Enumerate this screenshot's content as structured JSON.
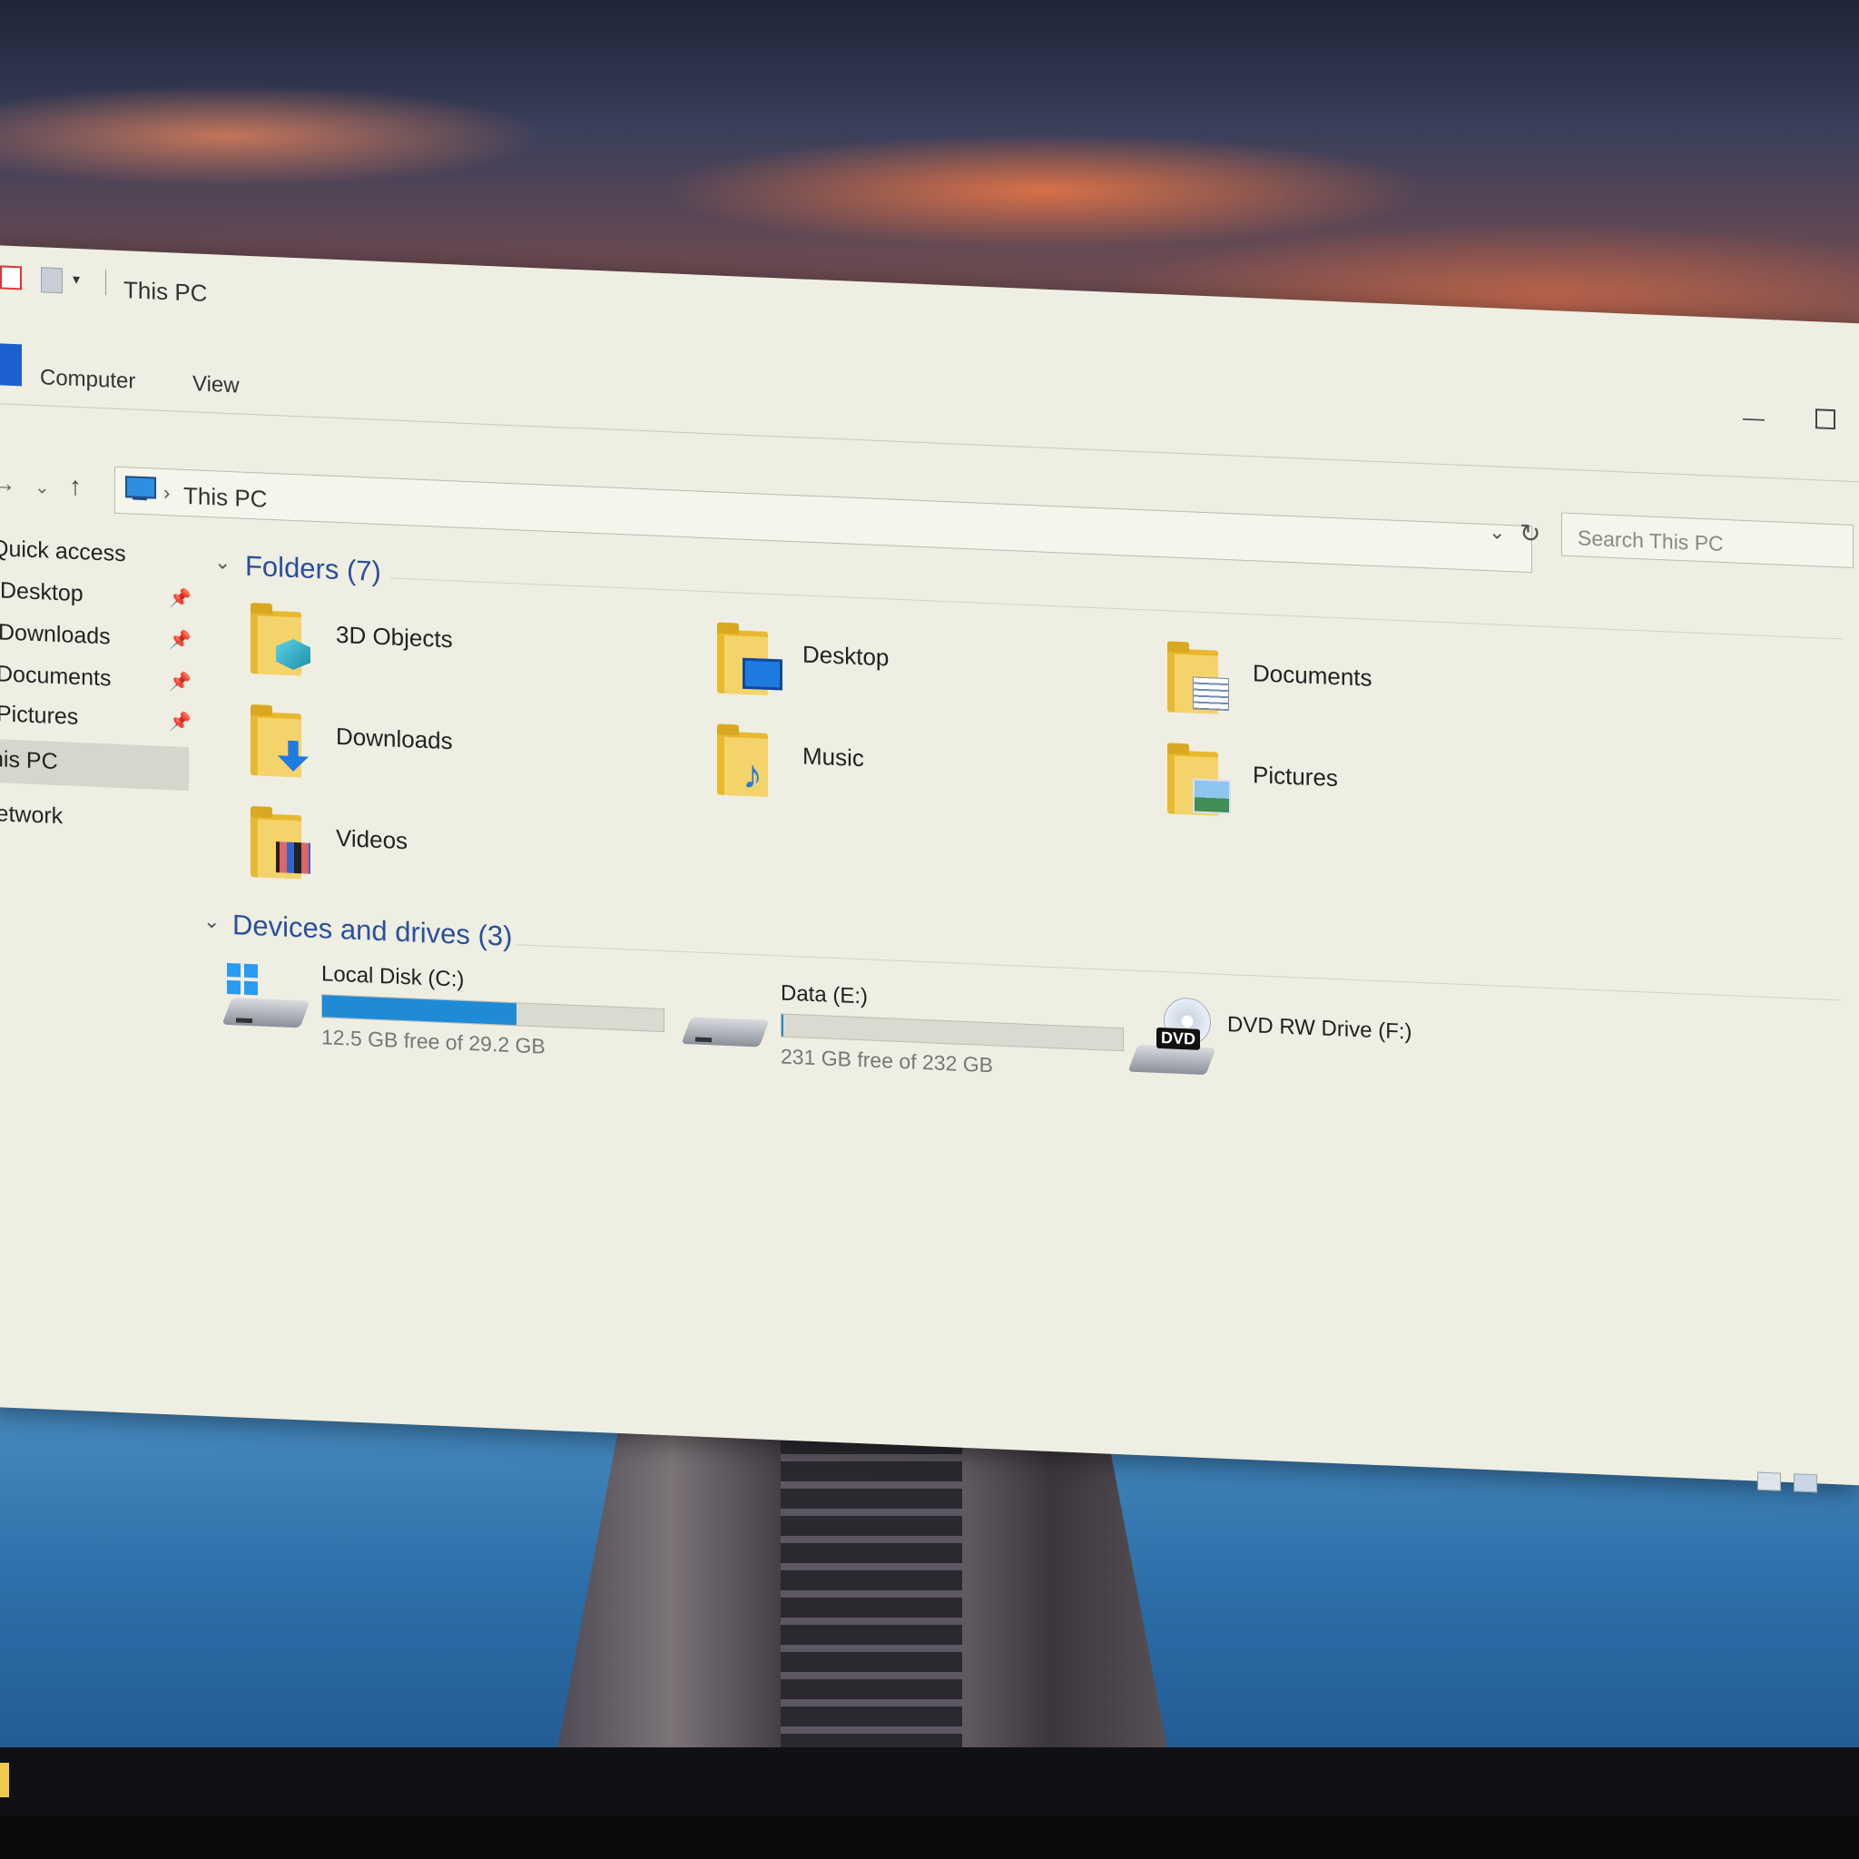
{
  "window": {
    "title": "This PC"
  },
  "ribbon": {
    "tabs": [
      "Computer",
      "View"
    ]
  },
  "address": {
    "crumb": "This PC"
  },
  "search": {
    "placeholder": "Search This PC"
  },
  "nav": {
    "quick_access": "Quick access",
    "items": [
      {
        "label": "Desktop",
        "pinned": true
      },
      {
        "label": "Downloads",
        "pinned": true
      },
      {
        "label": "Documents",
        "pinned": true
      },
      {
        "label": "Pictures",
        "pinned": true
      }
    ],
    "this_pc": "his PC",
    "network": "letwork"
  },
  "folders": {
    "header": "Folders (7)",
    "items": [
      {
        "label": "3D Objects",
        "icon": "3d-objects-icon"
      },
      {
        "label": "Desktop",
        "icon": "desktop-icon"
      },
      {
        "label": "Documents",
        "icon": "documents-icon"
      },
      {
        "label": "Downloads",
        "icon": "download-arrow-icon"
      },
      {
        "label": "Music",
        "icon": "music-note-icon"
      },
      {
        "label": "Pictures",
        "icon": "pictures-icon"
      },
      {
        "label": "Videos",
        "icon": "film-strip-icon"
      }
    ]
  },
  "drives": {
    "header": "Devices and drives (3)",
    "items": [
      {
        "name": "Local Disk (C:)",
        "free_text": "12.5 GB free of 29.2 GB",
        "used_fraction": 0.57,
        "icon": "windows-drive-icon"
      },
      {
        "name": "Data (E:)",
        "free_text": "231 GB free of 232 GB",
        "used_fraction": 0.004,
        "icon": "hard-drive-icon"
      },
      {
        "name": "DVD RW Drive (F:)",
        "label": "DVD",
        "icon": "dvd-drive-icon"
      }
    ]
  },
  "colors": {
    "accent": "#1f8bd7",
    "group_header": "#2a4f9e",
    "folder": "#e8b92e"
  }
}
